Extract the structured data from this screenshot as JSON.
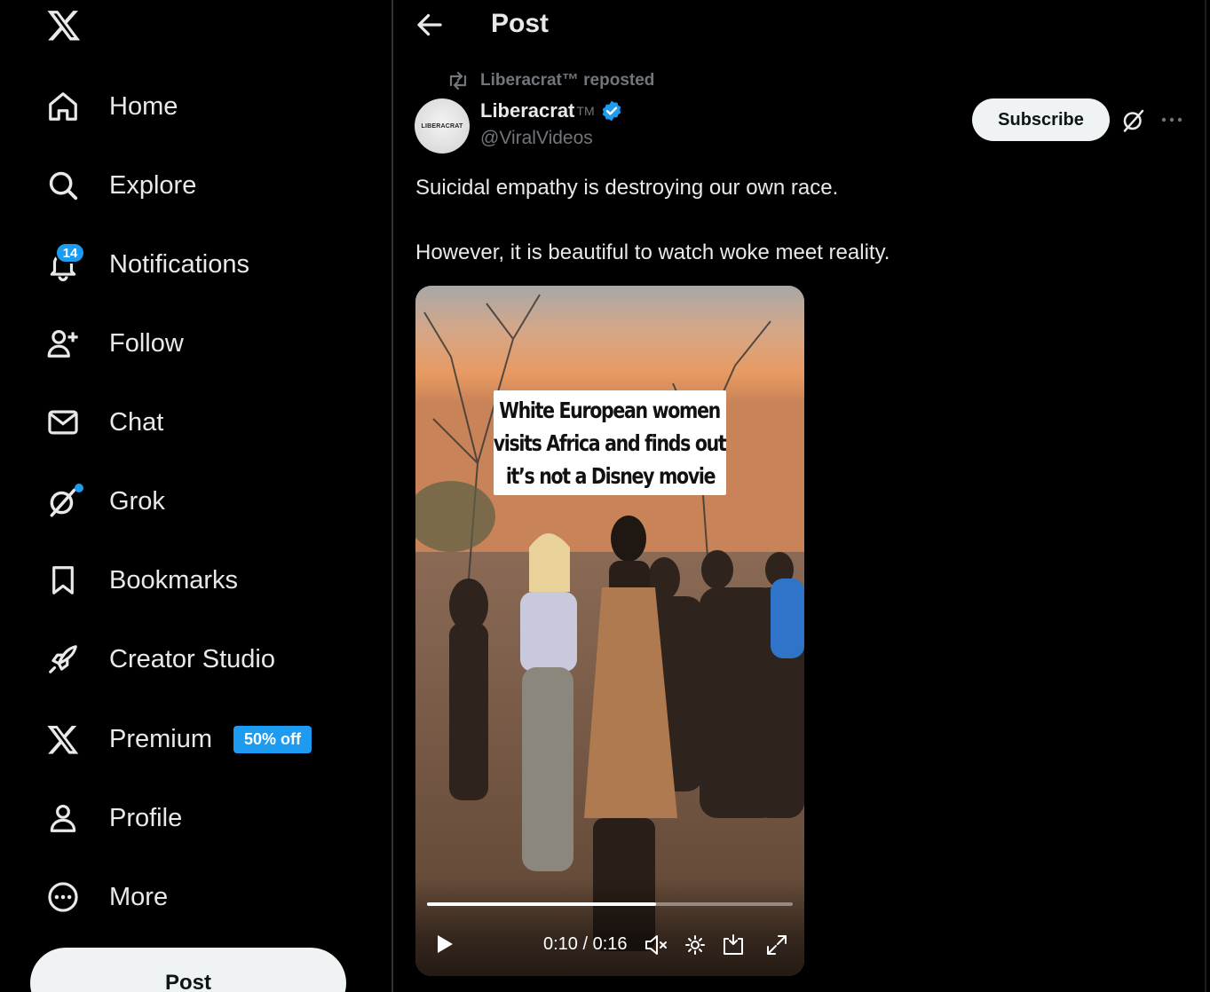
{
  "sidebar": {
    "logo": "x-logo-icon",
    "nav": [
      {
        "label": "Home",
        "icon": "home-icon"
      },
      {
        "label": "Explore",
        "icon": "search-icon"
      },
      {
        "label": "Notifications",
        "icon": "bell-icon",
        "badge": "14"
      },
      {
        "label": "Follow",
        "icon": "person-add-icon"
      },
      {
        "label": "Chat",
        "icon": "envelope-icon"
      },
      {
        "label": "Grok",
        "icon": "grok-icon"
      },
      {
        "label": "Bookmarks",
        "icon": "bookmark-icon"
      },
      {
        "label": "Creator Studio",
        "icon": "rocket-icon"
      },
      {
        "label": "Premium",
        "icon": "x-logo-icon",
        "promo": "50% off"
      },
      {
        "label": "Profile",
        "icon": "person-icon"
      },
      {
        "label": "More",
        "icon": "more-circle-icon"
      }
    ],
    "post_button": "Post"
  },
  "header": {
    "title": "Post",
    "back_icon": "arrow-left-icon"
  },
  "post": {
    "repost_by": "Liberacrat™ reposted",
    "author_name": "Liberacrat",
    "author_tm": "TM",
    "avatar_text": "LIBERACRAT",
    "handle": "@ViralVideos",
    "subscribe": "Subscribe",
    "text_line1": "Suicidal empathy is destroying our own race.",
    "text_line2": "However, it is beautiful to watch woke meet reality.",
    "video": {
      "caption_lines": [
        "White European women",
        "visits Africa and finds out",
        "it’s not a Disney movie"
      ],
      "time": "0:10 / 0:16",
      "progress": 0.625
    }
  },
  "colors": {
    "accent": "#1d9bf0",
    "background": "#000000",
    "text": "#e7e9ea",
    "secondary": "#71767b"
  }
}
